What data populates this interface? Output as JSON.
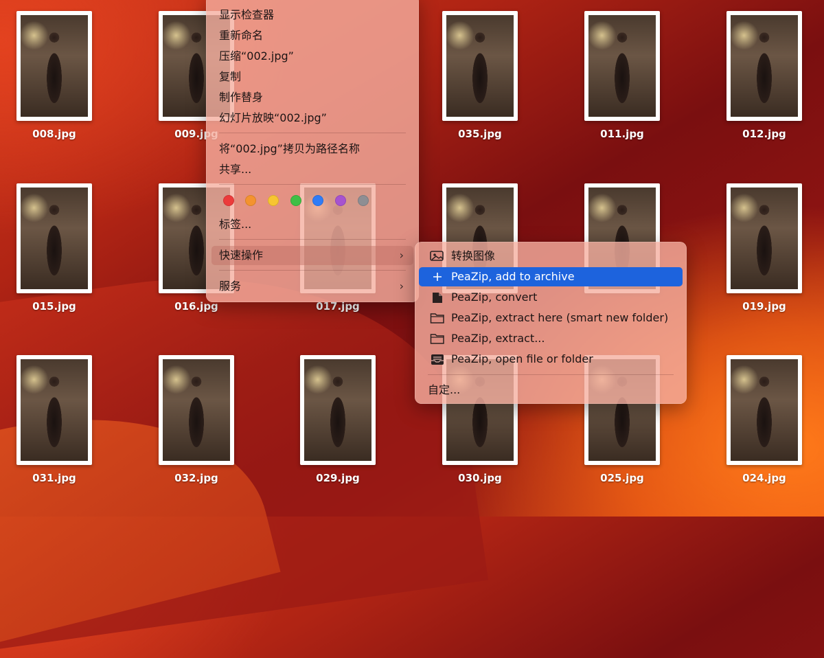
{
  "files": [
    {
      "name": "008.jpg"
    },
    {
      "name": "009.jpg"
    },
    {
      "name": "035.jpg"
    },
    {
      "name": "011.jpg"
    },
    {
      "name": "012.jpg"
    },
    {
      "name": "015.jpg"
    },
    {
      "name": "016.jpg"
    },
    {
      "name": "017.jpg"
    },
    {
      "name": "019.jpg"
    },
    {
      "name": "031.jpg"
    },
    {
      "name": "032.jpg"
    },
    {
      "name": "029.jpg"
    },
    {
      "name": "030.jpg"
    },
    {
      "name": "025.jpg"
    },
    {
      "name": "024.jpg"
    }
  ],
  "context_menu": {
    "items": [
      {
        "label": "显示检查器"
      },
      {
        "label": "重新命名"
      },
      {
        "label": "压缩“002.jpg”"
      },
      {
        "label": "复制"
      },
      {
        "label": "制作替身"
      },
      {
        "label": "幻灯片放映“002.jpg”"
      },
      {
        "label": "将“002.jpg”拷贝为路径名称"
      },
      {
        "label": "共享..."
      },
      {
        "label": "标签..."
      },
      {
        "label": "快速操作"
      },
      {
        "label": "服务"
      }
    ],
    "tag_colors": [
      "#ec3b3b",
      "#f4932f",
      "#f7c531",
      "#3fbf45",
      "#2f7cf6",
      "#a753cf",
      "#8e8e93"
    ],
    "submenu_chevron": "›"
  },
  "quick_actions": {
    "items": [
      {
        "label": "转换图像",
        "icon": "convert-image-icon"
      },
      {
        "label": "PeaZip, add to archive",
        "icon": "plus-icon"
      },
      {
        "label": "PeaZip, convert",
        "icon": "document-icon"
      },
      {
        "label": "PeaZip, extract here (smart new folder)",
        "icon": "folder-icon"
      },
      {
        "label": "PeaZip, extract...",
        "icon": "folder-icon"
      },
      {
        "label": "PeaZip, open file or folder",
        "icon": "tray-icon"
      }
    ],
    "customize": "自定..."
  }
}
